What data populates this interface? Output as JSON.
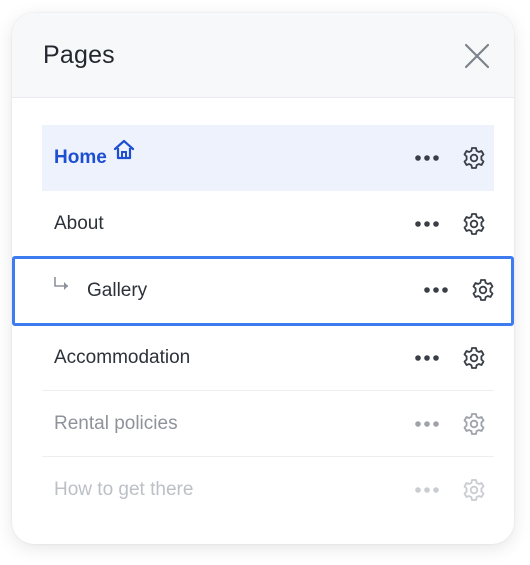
{
  "panel": {
    "title": "Pages",
    "close_icon": "close-icon"
  },
  "pages": [
    {
      "label": "Home",
      "state": "active",
      "icon": "home-icon"
    },
    {
      "label": "About",
      "state": "normal"
    },
    {
      "label": "Gallery",
      "state": "selected",
      "subpage": true
    },
    {
      "label": "Accommodation",
      "state": "normal"
    },
    {
      "label": "Rental policies",
      "state": "faded"
    },
    {
      "label": "How to get there",
      "state": "faded2"
    }
  ],
  "colors": {
    "accent": "#3d7cf0",
    "active_text": "#1d4fd2",
    "active_bg": "#eef2fc"
  }
}
